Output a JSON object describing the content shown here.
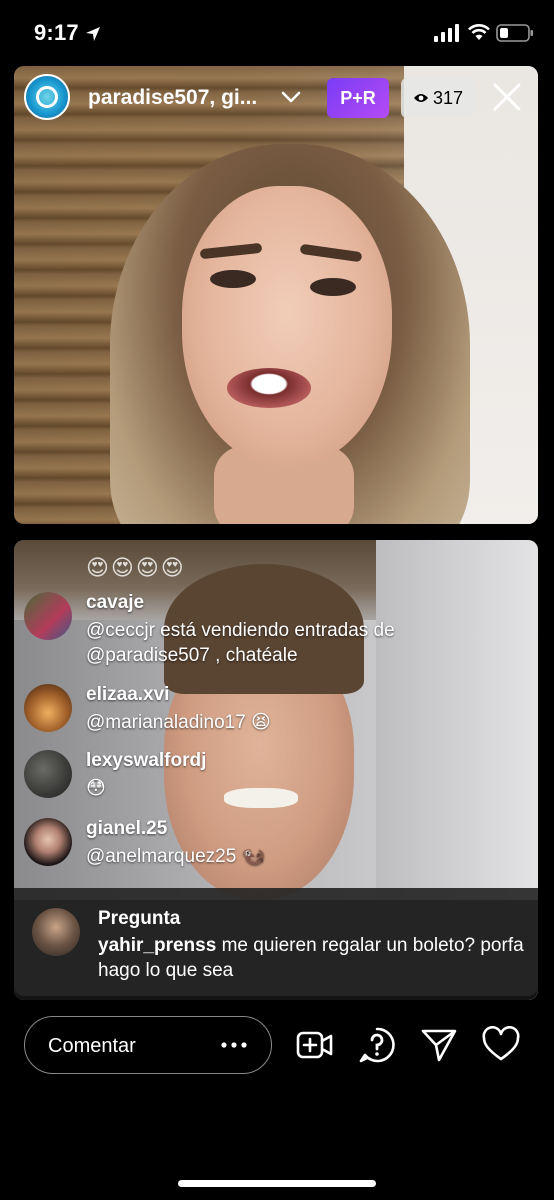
{
  "status_bar": {
    "time": "9:17"
  },
  "header": {
    "broadcaster_name": "paradise507, gi...",
    "badge_label": "P+R",
    "viewer_count": "317"
  },
  "emoji_row": "😍😍😍😍",
  "comments": [
    {
      "username": "cavaje",
      "text": "@ceccjr está vendiendo entradas de @paradise507 , chatéale"
    },
    {
      "username": "elizaa.xvi",
      "text": "@marianaladino17 😫"
    },
    {
      "username": "lexyswalfordj",
      "text": "😳"
    },
    {
      "username": "gianel.25",
      "text": "@anelmarquez25 🦦"
    }
  ],
  "question": {
    "title": "Pregunta",
    "username": "yahir_prenss",
    "text": "me quieren regalar un boleto? porfa hago lo que sea"
  },
  "comment_box": {
    "placeholder": "Comentar"
  },
  "colors": {
    "badge_gradient_start": "#7a3cf5",
    "badge_gradient_end": "#b44bf4",
    "background": "#000000"
  },
  "icons": [
    "location-arrow-icon",
    "signal-icon",
    "wifi-icon",
    "battery-icon",
    "chevron-down-icon",
    "eye-icon",
    "close-icon",
    "more-icon",
    "add-guest-icon",
    "question-icon",
    "send-icon",
    "heart-icon"
  ]
}
